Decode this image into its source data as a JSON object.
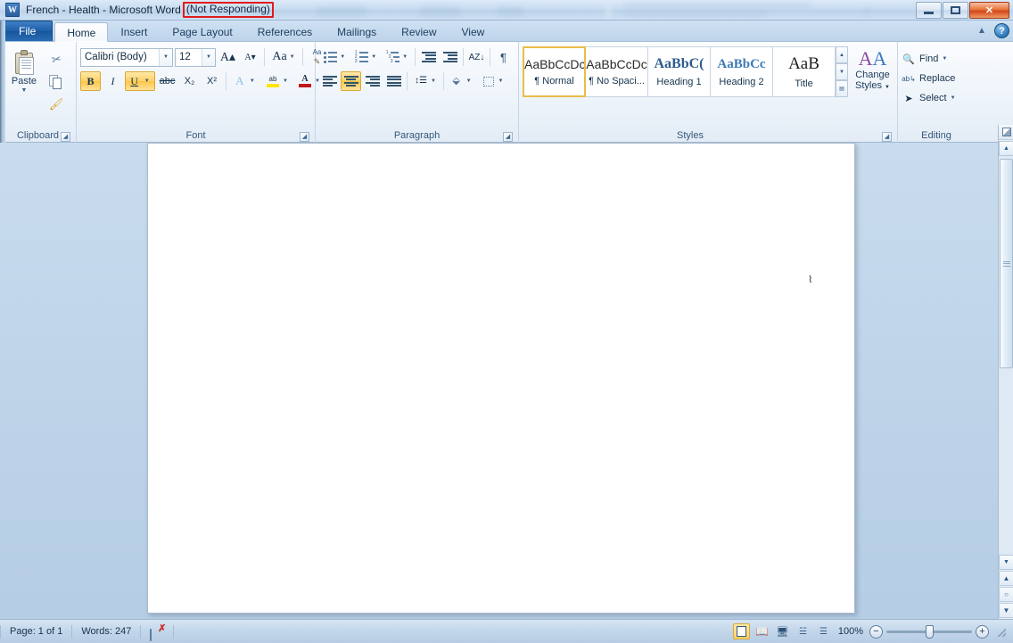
{
  "window": {
    "app_icon": "word-logo-icon",
    "title": "French - Health - Microsoft Word",
    "status_suffix": "(Not Responding)",
    "highlight_color": "#e01b1b",
    "minimize_label": "Minimize",
    "maximize_label": "Restore",
    "close_label": "✕",
    "ghost_labels": [
      "Mailings",
      "Review",
      "View"
    ]
  },
  "tabs": [
    {
      "label": "File",
      "active": false
    },
    {
      "label": "Home",
      "active": true
    },
    {
      "label": "Insert",
      "active": false
    },
    {
      "label": "Page Layout",
      "active": false
    },
    {
      "label": "References",
      "active": false
    },
    {
      "label": "Mailings",
      "active": false
    },
    {
      "label": "Review",
      "active": false
    },
    {
      "label": "View",
      "active": false
    }
  ],
  "tabstrip_right": {
    "minimize_ribbon": "▲",
    "help": "?"
  },
  "ribbon": {
    "clipboard": {
      "group_label": "Clipboard",
      "paste_label": "Paste",
      "paste_arrow": "▼",
      "cut_label": "Cut",
      "copy_label": "Copy",
      "format_painter_label": "Format Painter",
      "dialog_launcher": "◢"
    },
    "font": {
      "group_label": "Font",
      "font_name": "Calibri (Body)",
      "font_size": "12",
      "grow_font": "A",
      "shrink_font": "A",
      "change_case": "Aa",
      "clear_formatting": "Aa",
      "bold": "B",
      "bold_active": true,
      "italic": "I",
      "italic_active": false,
      "underline": "U",
      "underline_active": true,
      "strikethrough": "abc",
      "subscript": "X₂",
      "superscript": "X²",
      "text_effects": "A",
      "highlight": "ab",
      "font_color": "A",
      "font_color_swatch": "#c0181c",
      "dropdown_arrow": "▼",
      "dialog_launcher": "◢"
    },
    "paragraph": {
      "group_label": "Paragraph",
      "bullets": "Bullets",
      "numbering": "Numbering",
      "multilevel": "Multilevel List",
      "decrease_indent": "Decrease Indent",
      "increase_indent": "Increase Indent",
      "sort": "AZ↓",
      "show_marks": "¶",
      "align_left": "Align Left",
      "align_center": "Center",
      "align_center_active": true,
      "align_right": "Align Right",
      "justify": "Justify",
      "line_spacing": "Line Spacing",
      "shading": "Shading",
      "borders": "Borders",
      "dialog_launcher": "◢"
    },
    "styles": {
      "group_label": "Styles",
      "items": [
        {
          "sample": "AaBbCcDc",
          "name": "¶ Normal",
          "selected": true,
          "kind": "normal"
        },
        {
          "sample": "AaBbCcDc",
          "name": "¶ No Spaci...",
          "selected": false,
          "kind": "normal"
        },
        {
          "sample": "AaBbC(",
          "name": "Heading 1",
          "selected": false,
          "kind": "h1"
        },
        {
          "sample": "AaBbCc",
          "name": "Heading 2",
          "selected": false,
          "kind": "h2"
        },
        {
          "sample": "AaB",
          "name": "Title",
          "selected": false,
          "kind": "title"
        }
      ],
      "scroll_up": "▲",
      "scroll_down": "▼",
      "more": "▼",
      "change_styles_label_1": "Change",
      "change_styles_label_2": "Styles",
      "change_styles_arrow": "▼",
      "dialog_launcher": "◢"
    },
    "editing": {
      "group_label": "Editing",
      "find_label": "Find",
      "find_arrow": "▼",
      "replace_label": "Replace",
      "select_label": "Select",
      "select_arrow": "▼"
    }
  },
  "document": {
    "caret": "⌇",
    "page_content": ""
  },
  "scrollbar": {
    "ruler_toggle": "View Ruler",
    "up_arrow": "▲",
    "down_arrow": "▼",
    "prev_object": "▲",
    "select_object": "○",
    "next_object": "▼"
  },
  "statusbar": {
    "page_text": "Page: 1 of 1",
    "words_text": "Words: 247",
    "proofing_label": "Proofing errors",
    "views": [
      {
        "name": "print-layout",
        "active": true
      },
      {
        "name": "full-screen-reading",
        "active": false
      },
      {
        "name": "web-layout",
        "active": false
      },
      {
        "name": "outline",
        "active": false
      },
      {
        "name": "draft",
        "active": false
      }
    ],
    "zoom_level": "100%",
    "zoom_out": "−",
    "zoom_in": "+"
  }
}
